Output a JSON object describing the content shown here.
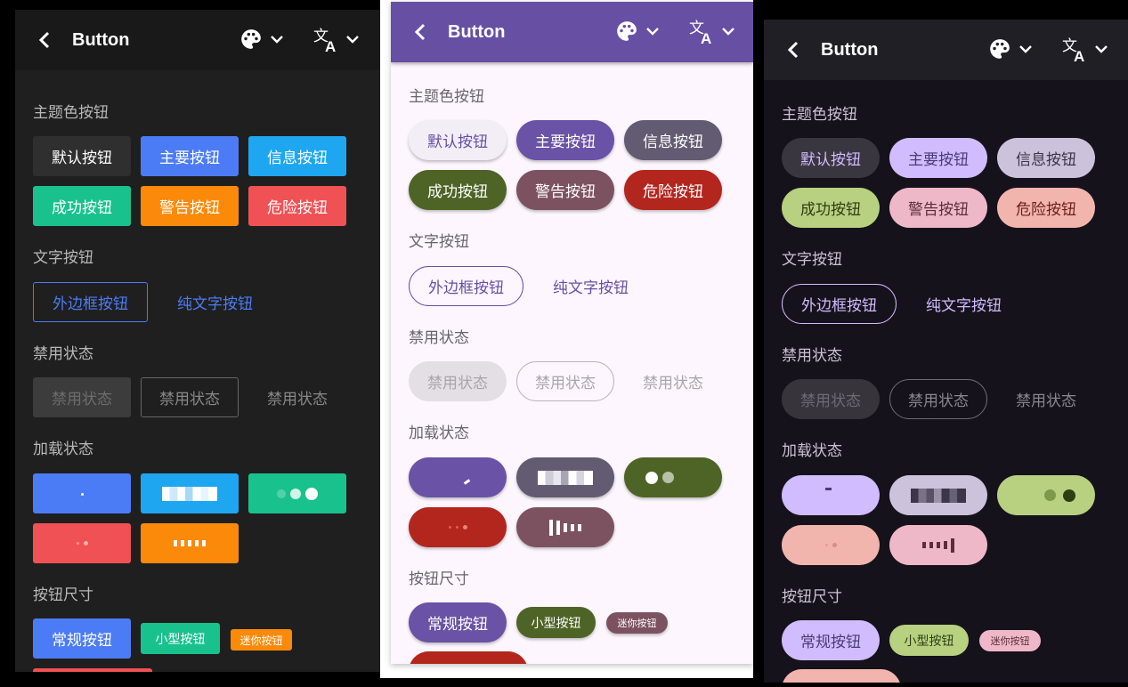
{
  "title": "Button",
  "sections": {
    "theme": "主题色按钮",
    "text": "文字按钮",
    "disabled": "禁用状态",
    "loading": "加载状态",
    "size": "按钮尺寸"
  },
  "buttons": {
    "default": "默认按钮",
    "primary": "主要按钮",
    "info": "信息按钮",
    "success": "成功按钮",
    "warning": "警告按钮",
    "danger": "危险按钮",
    "outline": "外边框按钮",
    "plain": "纯文字按钮",
    "disabled": "禁用状态",
    "normal": "常规按钮",
    "small": "小型按钮",
    "mini": "迷你按钮"
  },
  "icons": [
    "chevron-left-icon",
    "palette-icon",
    "chevron-down-icon",
    "translate-icon"
  ],
  "themes": {
    "dark_blue": {
      "default": "#2f2f30",
      "primary": "#4c7cf5",
      "info": "#1ea7f0",
      "success": "#19c28d",
      "warning": "#fb8a0a",
      "danger": "#f05154",
      "accent": "#4c7cf5"
    },
    "light_purple": {
      "default": "#f3eef6",
      "primary": "#6a52a6",
      "info": "#625b71",
      "success": "#4e6426",
      "warning": "#7d5260",
      "danger": "#b3261e",
      "accent": "#6750a4"
    },
    "dark_purple": {
      "default": "#3a3640",
      "primary": "#d0bcfe",
      "info": "#ccc2dc",
      "success": "#b7d180",
      "warning": "#efb8c8",
      "danger": "#f2b5ae",
      "accent": "#d0bcfe"
    }
  }
}
